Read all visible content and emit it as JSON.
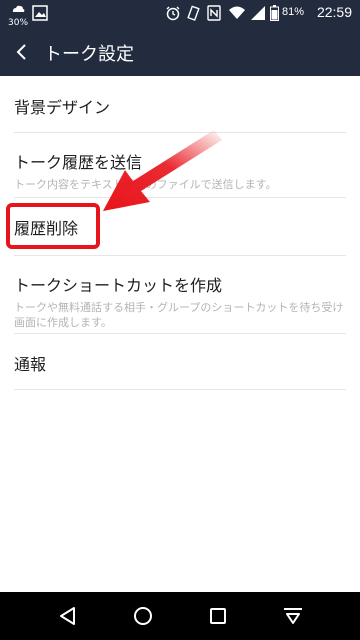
{
  "status_bar": {
    "weather_label": "30%",
    "battery_percent": "81%",
    "clock": "22:59",
    "icons": [
      "weather-icon",
      "gallery-icon",
      "alarm-icon",
      "vibrate-icon",
      "nfc-icon",
      "wifi-icon",
      "signal-icon",
      "battery-icon"
    ]
  },
  "app_bar": {
    "title": "トーク設定",
    "back_icon": "back-arrow-icon"
  },
  "settings": {
    "items": [
      {
        "title": "背景デザイン"
      },
      {
        "title": "トーク履歴を送信",
        "subtitle": "トーク内容をテキスト形式のファイルで送信します。"
      },
      {
        "title": "履歴削除"
      },
      {
        "title": "トークショートカットを作成",
        "subtitle": "トークや無料通話する相手・グループのショートカットを待ち受け画面に作成します。"
      },
      {
        "title": "通報"
      }
    ]
  },
  "annotation": {
    "color": "#e8141b",
    "highlighted_item": "履歴削除"
  },
  "nav_bar": {
    "icons": [
      "back-triangle-icon",
      "home-circle-icon",
      "recents-square-icon",
      "notification-pull-icon"
    ]
  },
  "colors": {
    "bar_background": "#232b3e",
    "text_primary": "#1e1e1e",
    "text_secondary": "#b4b4b4",
    "divider": "#e6e6e6"
  }
}
